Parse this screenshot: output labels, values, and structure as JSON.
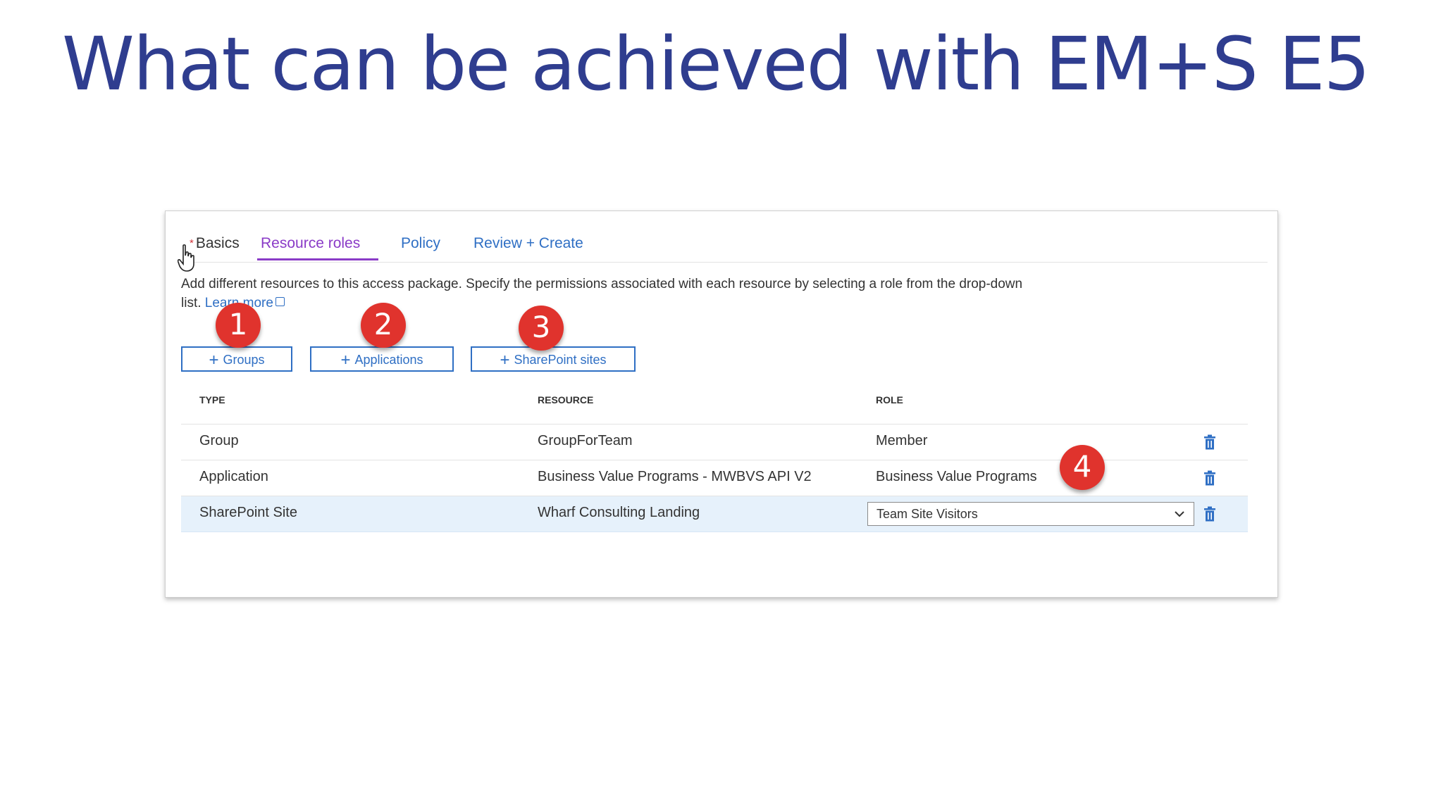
{
  "slide": {
    "title": "What can be achieved with EM+S E5"
  },
  "tabs": [
    {
      "label": "Basics",
      "required_mark": "*"
    },
    {
      "label": "Resource roles"
    },
    {
      "label": "Policy"
    },
    {
      "label": "Review + Create"
    }
  ],
  "description": {
    "text": "Add different resources to this access package. Specify the permissions associated with each resource by selecting a role from the drop-down list.",
    "link": "Learn more"
  },
  "buttons": {
    "groups": "Groups",
    "applications": "Applications",
    "sharepoint": "SharePoint sites"
  },
  "table": {
    "headers": [
      "TYPE",
      "RESOURCE",
      "ROLE"
    ],
    "rows": [
      {
        "type": "Group",
        "resource": "GroupForTeam",
        "role": "Member"
      },
      {
        "type": "Application",
        "resource": "Business Value Programs - MWBVS API V2",
        "role": "Business Value Programs"
      },
      {
        "type": "SharePoint Site",
        "resource": "Wharf Consulting Landing",
        "role": "Team Site Visitors"
      }
    ]
  },
  "callouts": [
    "1",
    "2",
    "3",
    "4"
  ],
  "colors": {
    "title": "#2f3d8f",
    "link": "#2f6fc4",
    "active_tab": "#8a3bc7",
    "callout": "#e0332d",
    "selected_row": "#e6f1fb"
  }
}
